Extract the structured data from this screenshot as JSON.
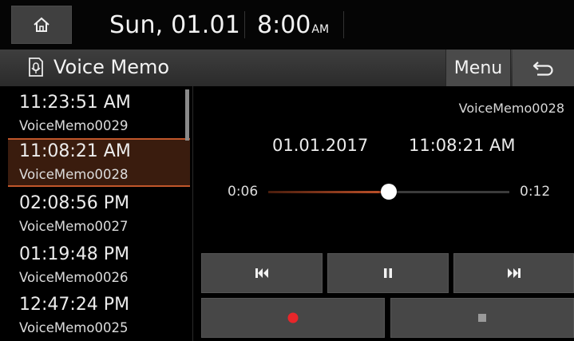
{
  "status": {
    "date": "Sun, 01.01",
    "time": "8:00",
    "ampm": "AM"
  },
  "app": {
    "title": "Voice Memo",
    "menu_label": "Menu"
  },
  "list": {
    "items": [
      {
        "time": "11:23:51 AM",
        "name": "VoiceMemo0029",
        "selected": false
      },
      {
        "time": "11:08:21 AM",
        "name": "VoiceMemo0028",
        "selected": true
      },
      {
        "time": "02:08:56 PM",
        "name": "VoiceMemo0027",
        "selected": false
      },
      {
        "time": "01:19:48 PM",
        "name": "VoiceMemo0026",
        "selected": false
      },
      {
        "time": "12:47:24 PM",
        "name": "VoiceMemo0025",
        "selected": false
      }
    ]
  },
  "detail": {
    "file_name": "VoiceMemo0028",
    "date": "01.01.2017",
    "time": "11:08:21 AM",
    "elapsed": "0:06",
    "total": "0:12",
    "progress": 0.5
  },
  "controls": {
    "prev_icon": "skip-previous-icon",
    "pause_icon": "pause-icon",
    "next_icon": "skip-next-icon",
    "record_icon": "record-icon",
    "stop_icon": "stop-icon"
  },
  "colors": {
    "accent": "#c0562a",
    "selected_bg": "#3a1c0e",
    "record": "#e8262a",
    "button_bg": "#474747"
  }
}
